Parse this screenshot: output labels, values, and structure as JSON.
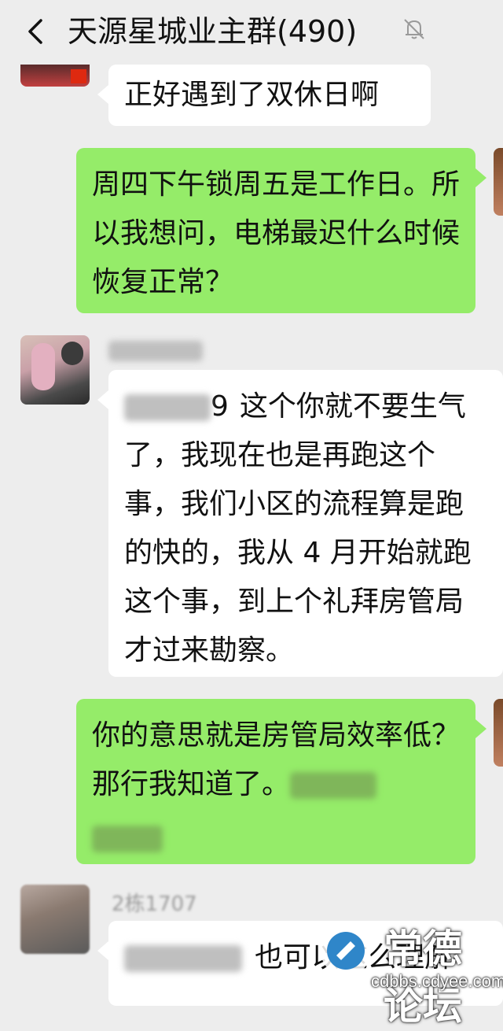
{
  "header": {
    "title": "天源星城业主群(490)",
    "back_icon": "chevron-left-icon",
    "mute_icon": "bell-muted-icon"
  },
  "messages": [
    {
      "side": "in",
      "text": "正好遇到了双休日啊"
    },
    {
      "side": "out",
      "text": "周四下午锁周五是工作日。所以我想问，电梯最迟什么时候恢复正常？"
    },
    {
      "side": "in",
      "mention_suffix": "9",
      "text": "这个你就不要生气了，我现在也是再跑这个事，我们小区的流程算是跑的快的，我从 4 月开始就跑这个事，到上个礼拜房管局才过来勘察。"
    },
    {
      "side": "out",
      "text": "你的意思就是房管局效率低？那行我知道了。"
    },
    {
      "side": "in",
      "sender": "2栋1707",
      "text": "也可以这么理解"
    }
  ],
  "watermark": {
    "text": "cdbbs.cdyee.com",
    "brand": "常德论坛"
  },
  "colors": {
    "background": "#ededed",
    "incoming": "#ffffff",
    "outgoing": "#95ec69"
  }
}
